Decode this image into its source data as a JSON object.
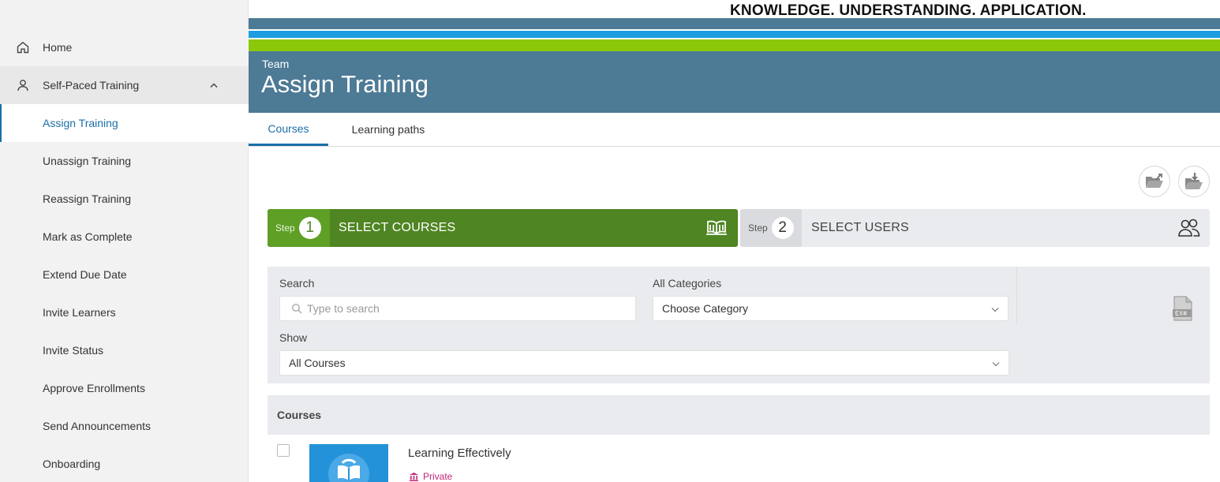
{
  "sidebar": {
    "items": [
      {
        "label": "Home",
        "icon": "home-icon"
      },
      {
        "label": "Self-Paced Training",
        "icon": "user-icon"
      },
      {
        "label": "Assign Training"
      },
      {
        "label": "Unassign Training"
      },
      {
        "label": "Reassign Training"
      },
      {
        "label": "Mark as Complete"
      },
      {
        "label": "Extend Due Date"
      },
      {
        "label": "Invite Learners"
      },
      {
        "label": "Invite Status"
      },
      {
        "label": "Approve Enrollments"
      },
      {
        "label": "Send Announcements"
      },
      {
        "label": "Onboarding"
      }
    ]
  },
  "brand": {
    "tagline": "KNOWLEDGE. UNDERSTANDING. APPLICATION.",
    "colors": {
      "steel": "#4d7a95",
      "blue": "#1e9ee0",
      "lime": "#8cc80a"
    }
  },
  "header": {
    "subtitle": "Team",
    "title": "Assign Training"
  },
  "tabs": [
    {
      "label": "Courses",
      "active": true
    },
    {
      "label": "Learning paths",
      "active": false
    }
  ],
  "toolbar": {
    "icons": [
      "open-folder-icon",
      "download-folder-icon"
    ]
  },
  "steps": [
    {
      "word": "Step",
      "number": "1",
      "label": "SELECT COURSES",
      "icon": "open-book-icon",
      "active": true,
      "color": "#4f8522"
    },
    {
      "word": "Step",
      "number": "2",
      "label": "SELECT USERS",
      "icon": "users-icon",
      "active": false
    }
  ],
  "filters": {
    "search_label": "Search",
    "search_placeholder": "Type to search",
    "category_label": "All Categories",
    "category_value": "Choose Category",
    "show_label": "Show",
    "show_value": "All Courses",
    "export_icon": "excel-export-icon"
  },
  "courses": {
    "header": "Courses",
    "items": [
      {
        "title": "Learning Effectively",
        "visibility": "Private",
        "visibility_color": "#c0267a"
      }
    ]
  }
}
